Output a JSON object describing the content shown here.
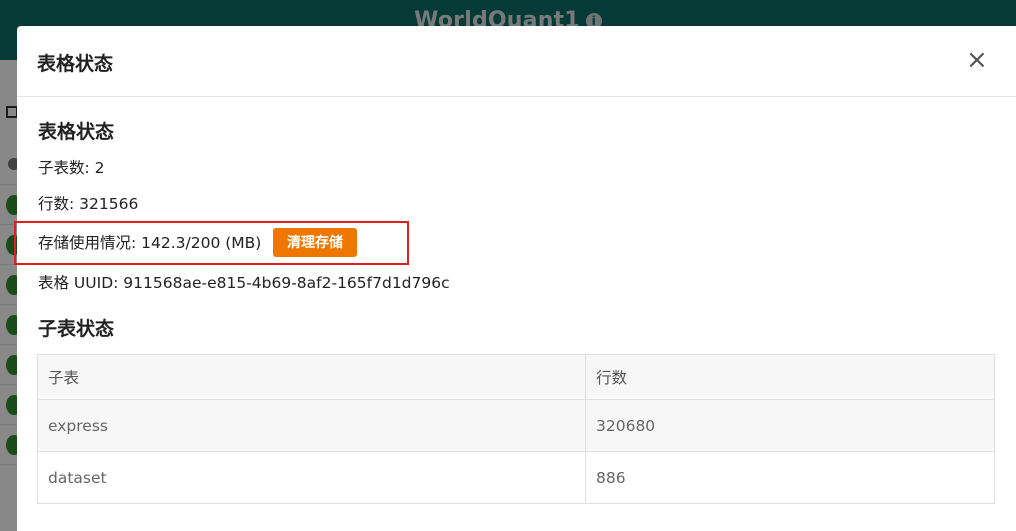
{
  "app": {
    "title": "WorldQuant1",
    "info_icon": "i"
  },
  "modal": {
    "title": "表格状态",
    "close_icon": "×",
    "table_status": {
      "heading": "表格状态",
      "subtable_count": "子表数: 2",
      "row_count": "行数: 321566",
      "storage_usage": "存储使用情况: 142.3/200 (MB)",
      "clean_button": "清理存储",
      "uuid": "表格 UUID: 911568ae-e815-4b69-8af2-165f7d1d796c"
    },
    "subtable_status": {
      "heading": "子表状态",
      "columns": [
        "子表",
        "行数"
      ],
      "rows": [
        [
          "express",
          "320680"
        ],
        [
          "dataset",
          "886"
        ]
      ]
    }
  },
  "colors": {
    "header_bg": "#0a6b63",
    "clean_button_bg": "#ee7700",
    "highlight_border": "#e02020"
  }
}
